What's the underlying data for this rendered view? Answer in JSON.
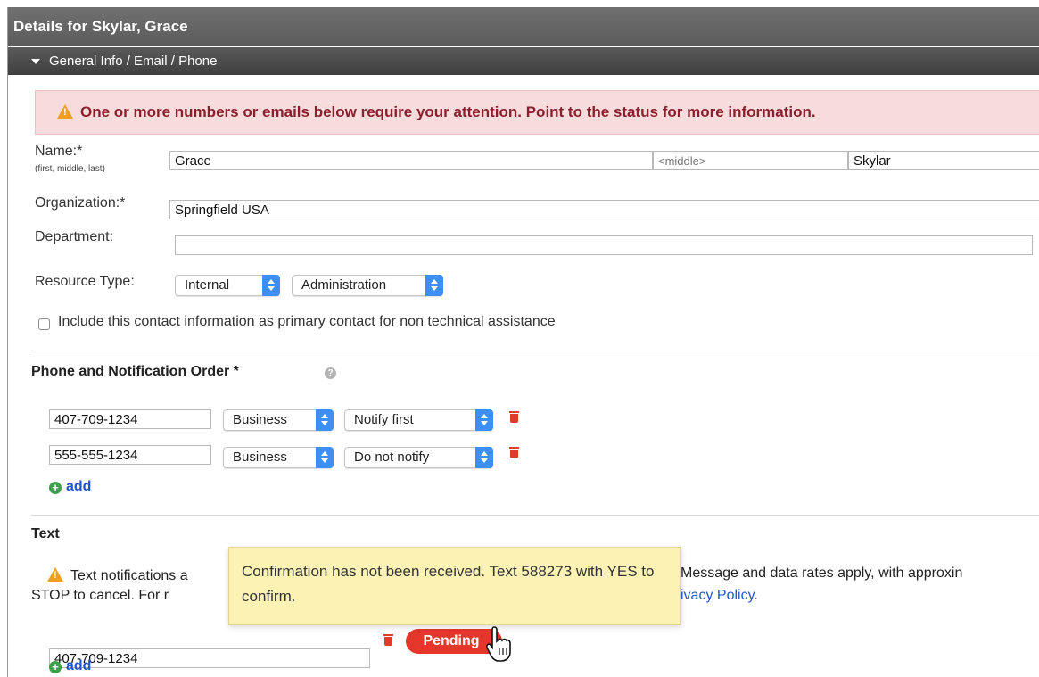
{
  "window": {
    "title": "Details for Skylar, Grace"
  },
  "section": {
    "label": "General Info / Email / Phone"
  },
  "alert": {
    "message": "One or more numbers or emails below require your attention. Point to the status for more information."
  },
  "name": {
    "label": "Name:*",
    "hint": "(first, middle, last)",
    "first": "Grace",
    "middle_placeholder": "<middle>",
    "last": "Skylar"
  },
  "organization": {
    "label": "Organization:*",
    "value": "Springfield USA"
  },
  "department": {
    "label": "Department:",
    "value": ""
  },
  "resource_type": {
    "label": "Resource Type:",
    "type": "Internal",
    "category": "Administration"
  },
  "primary_contact": {
    "label": "Include this contact information as primary contact for non technical assistance",
    "checked": false
  },
  "phone_section": {
    "heading": "Phone and Notification Order *",
    "rows": [
      {
        "number": "407-709-1234",
        "type": "Business",
        "notify": "Notify first"
      },
      {
        "number": "555-555-1234",
        "type": "Business",
        "notify": "Do not notify"
      }
    ],
    "add_label": "add"
  },
  "text_section": {
    "heading": "Text",
    "notice_start": "Text notifications a",
    "notice_end": "Message and data rates apply, with approxin",
    "notice_line2_start": "STOP to cancel. For r",
    "privacy_link": "ivacy Policy",
    "privacy_suffix": ".",
    "number": "407-709-1234",
    "status": "Pending",
    "add_label": "add"
  },
  "tooltip": {
    "text": "Confirmation has not been received. Text 588273 with YES to confirm."
  },
  "colors": {
    "alert_bg": "#f6dcdc",
    "alert_text": "#8a1f2d",
    "pending_badge": "#e4362b",
    "select_arrows": "#3d8ff5",
    "tooltip_bg": "#fbf2b4",
    "link": "#2255cc",
    "add_icon": "#3aa349"
  }
}
